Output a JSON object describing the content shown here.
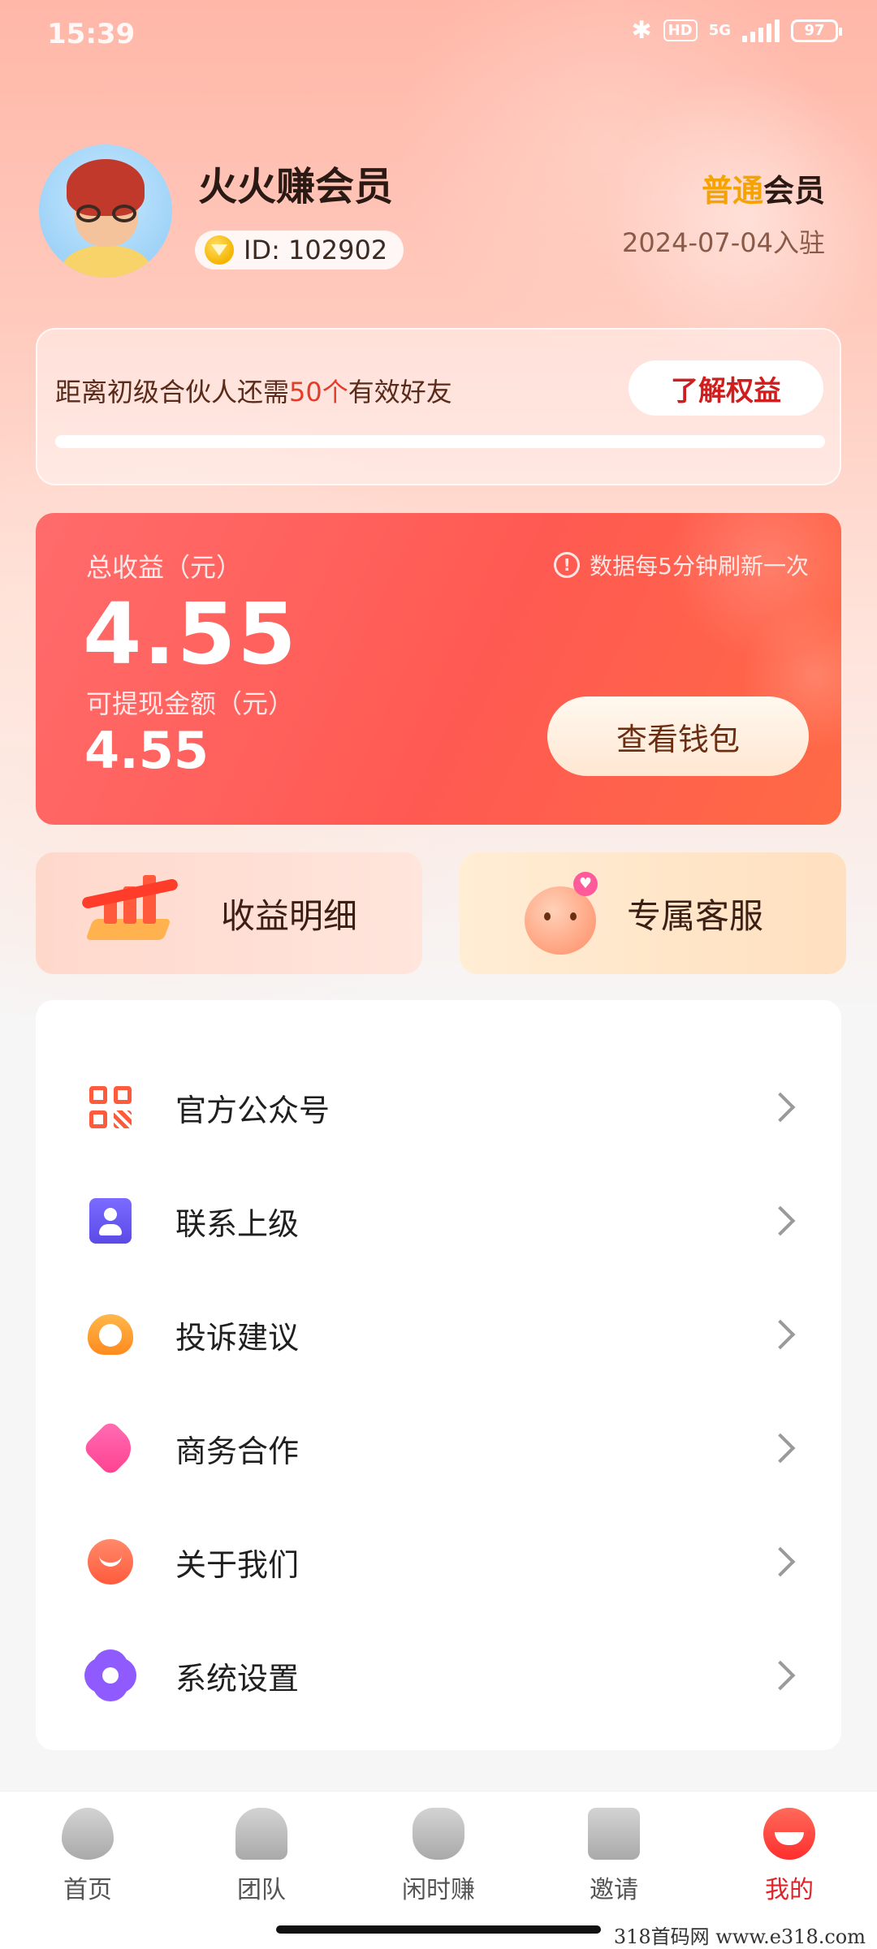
{
  "status_bar": {
    "time": "15:39",
    "battery": "97",
    "network": "5G",
    "hd": "HD"
  },
  "profile": {
    "username": "火火赚会员",
    "id_text": "ID: 102902",
    "level_highlight": "普通",
    "level_suffix": "会员",
    "join_date": "2024-07-04入驻"
  },
  "partner": {
    "text_prefix": "距离初级合伙人还需",
    "text_highlight": "50个",
    "text_suffix": "有效好友",
    "button": "了解权益",
    "progress_fraction": 0.0
  },
  "earnings": {
    "total_label": "总收益（元）",
    "total_value": "4.55",
    "refresh_note": "数据每5分钟刷新一次",
    "withdraw_label": "可提现金额（元）",
    "withdraw_value": "4.55",
    "wallet_button": "查看钱包"
  },
  "shortcuts": {
    "income_detail": "收益明细",
    "customer_service": "专属客服"
  },
  "menu": [
    {
      "label": "官方公众号",
      "icon": "qr-code-icon"
    },
    {
      "label": "联系上级",
      "icon": "contact-card-icon"
    },
    {
      "label": "投诉建议",
      "icon": "headset-icon"
    },
    {
      "label": "商务合作",
      "icon": "heart-handshake-icon"
    },
    {
      "label": "关于我们",
      "icon": "smile-chat-icon"
    },
    {
      "label": "系统设置",
      "icon": "gear-icon"
    }
  ],
  "bottom_nav": [
    {
      "label": "首页",
      "icon": "flame-icon"
    },
    {
      "label": "团队",
      "icon": "team-icon"
    },
    {
      "label": "闲时赚",
      "icon": "money-bag-icon"
    },
    {
      "label": "邀请",
      "icon": "invite-mail-icon"
    },
    {
      "label": "我的",
      "icon": "profile-smile-icon",
      "active": true
    }
  ],
  "watermark": "318首码网 www.e318.com"
}
